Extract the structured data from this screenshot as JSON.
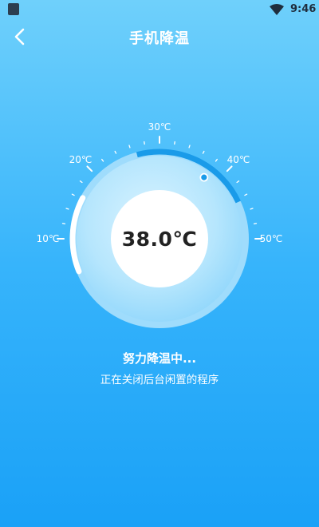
{
  "status_bar": {
    "time": "9:46"
  },
  "header": {
    "title": "手机降温",
    "back_icon": "chevron-left-icon"
  },
  "gauge": {
    "temperature": "38.0℃",
    "min_value": 10,
    "max_value": 50,
    "current_value": 38,
    "ticks": [
      {
        "value": 10,
        "label": "10℃"
      },
      {
        "value": 20,
        "label": "20℃"
      },
      {
        "value": 30,
        "label": "30℃"
      },
      {
        "value": 40,
        "label": "40℃"
      },
      {
        "value": 50,
        "label": "50℃"
      }
    ]
  },
  "status": {
    "title": "努力降温中...",
    "subtitle": "正在关闭后台闲置的程序"
  },
  "colors": {
    "background_top": "#6fd0fb",
    "background_bottom": "#1aa1f7",
    "accent": "#1a9be9"
  }
}
